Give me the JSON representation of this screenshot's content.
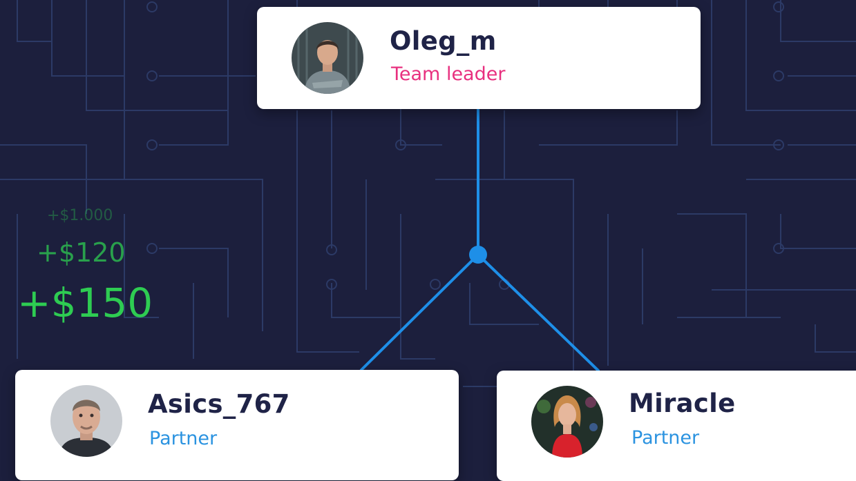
{
  "colors": {
    "background": "#1c1f3d",
    "circuit": "#2c3a66",
    "connector": "#1e8fe8",
    "leader_role": "#e8307f",
    "partner_role": "#2b93e0",
    "earnings": "#2ecc52",
    "name": "#1f2347"
  },
  "leader": {
    "name": "Oleg_m",
    "role": "Team leader",
    "avatar_icon": "person-photo-icon"
  },
  "partners": [
    {
      "name": "Asics_767",
      "role": "Partner",
      "avatar_icon": "person-photo-icon"
    },
    {
      "name": "Miracle",
      "role": "Partner",
      "avatar_icon": "person-photo-icon"
    }
  ],
  "earnings": [
    {
      "amount": "+$1.000"
    },
    {
      "amount": "+$120"
    },
    {
      "amount": "+$150"
    }
  ]
}
